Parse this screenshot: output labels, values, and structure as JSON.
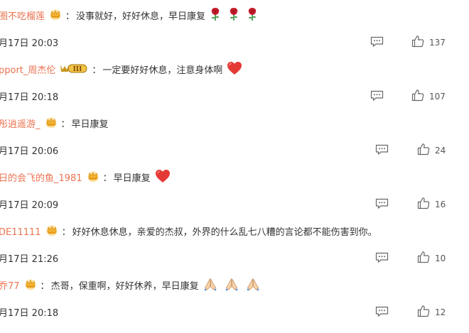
{
  "colors": {
    "username": "#eb7350",
    "text": "#333333",
    "crown": "#f4b433",
    "icon": "#666666"
  },
  "comments": [
    {
      "username": "圈不吃榴莲",
      "badge": "crown",
      "text": "没事就好，好好休息，早日康复",
      "emoji": [
        "rose-emoji",
        "rose-emoji",
        "rose-emoji"
      ],
      "date": "月17日 20:03",
      "likes": "137"
    },
    {
      "username": "pport_周杰伦",
      "badge": "vip-iii",
      "badge_text": "III",
      "text": "一定要好好休息，注意身体啊",
      "emoji": [
        "heart-emoji"
      ],
      "date": "月17日 20:18",
      "likes": "107"
    },
    {
      "username": "彤逍遥游_",
      "badge": "crown",
      "text": "早日康复",
      "emoji": [],
      "date": "月17日 20:06",
      "likes": "24"
    },
    {
      "username": "日的会飞的鱼_1981",
      "badge": "crown",
      "text": "早日康复",
      "emoji": [
        "heart-emoji"
      ],
      "date": "月17日 20:09",
      "likes": "16"
    },
    {
      "username": "DE11111",
      "badge": "crown",
      "text": "好好休息休息，亲爱的杰叔，外界的什么乱七八糟的言论都不能伤害到你。",
      "emoji": [],
      "date": "月17日 21:26",
      "likes": "10"
    },
    {
      "username": "乔77",
      "badge": "crown",
      "text": "杰哥，保重啊，好好休养，早日康复",
      "emoji": [
        "folded-hands-emoji",
        "folded-hands-emoji",
        "folded-hands-emoji"
      ],
      "date": "月17日 20:18",
      "likes": "12"
    }
  ],
  "separator": "：",
  "icons": {
    "reply": "reply-icon",
    "like": "thumbs-up-icon",
    "crown": "crown-icon",
    "rose": "rose-emoji",
    "heart": "heart-emoji",
    "pray": "folded-hands-emoji"
  }
}
